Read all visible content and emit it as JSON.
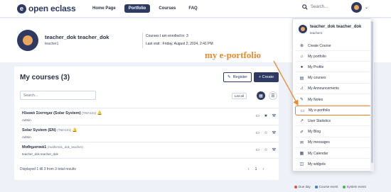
{
  "app": {
    "logo_text": "open eclass",
    "logo_glyph": "e"
  },
  "nav": {
    "items": [
      "Home Page",
      "Portfolio",
      "Courses",
      "FAQ"
    ],
    "active_index": 1
  },
  "search": {
    "placeholder": "Search..."
  },
  "profile": {
    "name": "teacher_dok teacher_dok",
    "username": "teacher1",
    "courses_enrolled": "Courses I am enrolled in: 3",
    "last_visit": "Last visit : Friday, August 2, 2024, 2:41 PM"
  },
  "main": {
    "title": "My courses  (3)",
    "register_label": "Register",
    "create_label": "+ Create",
    "search_placeholder": "Search...",
    "list_all_label": "List all",
    "courses": [
      {
        "title": "Ηλιακό Σύστημα (Solar System)",
        "code": "(TMA121)",
        "sub": "Admin"
      },
      {
        "title": "Solar System (EN)",
        "code": "(TMA121)",
        "sub": "Admin"
      },
      {
        "title": "Μαθηματικά1",
        "code": "(mathima1_dok_teacher)",
        "sub": "teacher_dok teacher_dok"
      }
    ],
    "footer_info": "Displayed 1 till 3 from 3 total results",
    "pager": {
      "prev": "‹",
      "page": "1",
      "next": "›"
    }
  },
  "dropdown": {
    "name": "teacher_dok teacher_dok",
    "username": "teacher1",
    "items": [
      {
        "label": "Create Course",
        "icon": "plus-circle-icon",
        "glyph": "⊕"
      },
      {
        "label": "My portfolio",
        "icon": "home-icon",
        "glyph": "⌂"
      },
      {
        "label": "My Profile",
        "icon": "user-icon",
        "glyph": "●"
      },
      {
        "label": "My courses",
        "icon": "book-icon",
        "glyph": "▤"
      },
      {
        "label": "My Announcements",
        "icon": "bell-icon",
        "glyph": "♫"
      },
      {
        "label": "My Notes",
        "icon": "note-icon",
        "glyph": "✎"
      },
      {
        "label": "My e-portfolio",
        "icon": "id-card-icon",
        "glyph": "▭"
      },
      {
        "label": "User Statistics",
        "icon": "chart-icon",
        "glyph": "↗"
      },
      {
        "label": "My Blog",
        "icon": "blog-icon",
        "glyph": "✐"
      },
      {
        "label": "My messages",
        "icon": "envelope-icon",
        "glyph": "✉"
      },
      {
        "label": "My Calendar",
        "icon": "calendar-icon",
        "glyph": "▦"
      },
      {
        "label": "My widgets",
        "icon": "widgets-icon",
        "glyph": "◫"
      }
    ],
    "highlighted_index": 6
  },
  "annotation": {
    "text": "my e-portfolio",
    "color": "#e98a2e"
  },
  "legend": {
    "items": [
      {
        "label": "Due day",
        "color": "#d9534f"
      },
      {
        "label": "Course event",
        "color": "#3a7bd5"
      },
      {
        "label": "System event",
        "color": "#4caf50"
      }
    ]
  },
  "colors": {
    "primary": "#2e3a62",
    "accent_orange": "#e87f2b",
    "logo_orange": "#e9a85b"
  }
}
